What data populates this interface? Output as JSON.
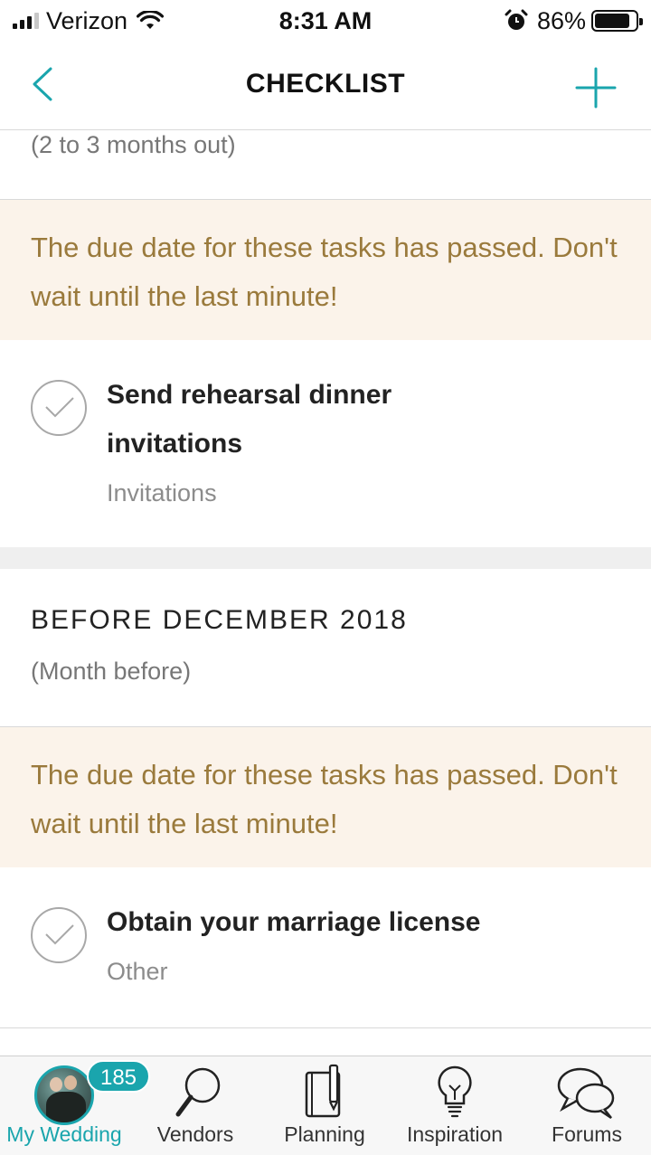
{
  "status_bar": {
    "carrier": "Verizon",
    "time": "8:31 AM",
    "battery": "86%",
    "battery_level": 0.86,
    "icons": [
      "signal-icon",
      "wifi-icon",
      "alarm-icon",
      "battery-icon"
    ]
  },
  "nav": {
    "title": "CHECKLIST",
    "back_icon": "chevron-left-icon",
    "add_icon": "plus-icon",
    "accent_color": "#1aa5ad"
  },
  "sections": [
    {
      "subtitle": "(2 to 3 months out)",
      "warning": "The due date for these tasks has passed. Don't wait until the last minute!",
      "tasks": [
        {
          "title": "Send rehearsal dinner invitations",
          "category": "Invitations"
        }
      ]
    },
    {
      "title": "BEFORE DECEMBER 2018",
      "subtitle": "(Month before)",
      "warning": "The due date for these tasks has passed. Don't wait until the last minute!",
      "tasks": [
        {
          "title": "Obtain your marriage license",
          "category": "Other"
        }
      ]
    }
  ],
  "tab_bar": {
    "badge": "185",
    "tabs": [
      {
        "label": "My Wedding",
        "icon": "avatar",
        "active": true
      },
      {
        "label": "Vendors",
        "icon": "magnifier-icon"
      },
      {
        "label": "Planning",
        "icon": "notebook-icon"
      },
      {
        "label": "Inspiration",
        "icon": "lightbulb-icon"
      },
      {
        "label": "Forums",
        "icon": "chat-bubbles-icon"
      }
    ]
  },
  "colors": {
    "accent": "#1aa5ad",
    "warning_bg": "#fbf3ea",
    "warning_text": "#9a7a3c"
  }
}
